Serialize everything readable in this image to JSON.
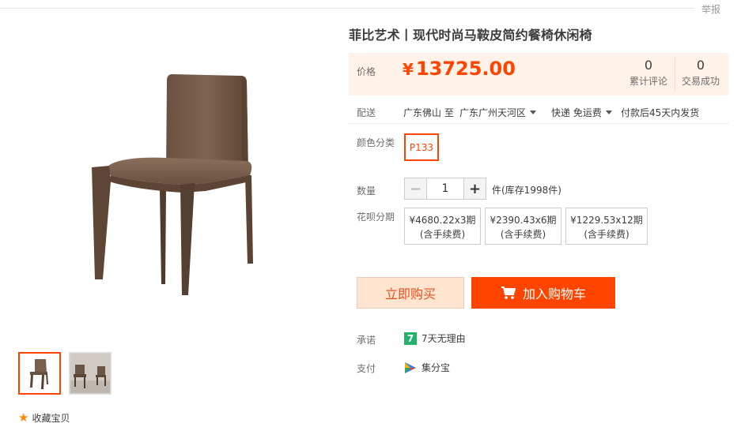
{
  "header": {
    "report_label": "举报"
  },
  "gallery": {
    "thumbs": [
      "chair-front",
      "chair-photo"
    ],
    "favorite_label": "收藏宝贝"
  },
  "product": {
    "title": "菲比艺术丨现代时尚马鞍皮简约餐椅休闲椅",
    "price_label": "价格",
    "currency": "¥",
    "price": "13725.00",
    "reviews_count": "0",
    "reviews_label": "累计评论",
    "deals_count": "0",
    "deals_label": "交易成功"
  },
  "shipping": {
    "label": "配送",
    "from": "广东佛山 至",
    "to": "广东广州天河区",
    "method": "快递 免运费",
    "delivery": "付款后45天内发货"
  },
  "sku": {
    "label": "颜色分类",
    "options": [
      "P133"
    ]
  },
  "quantity": {
    "label": "数量",
    "value": "1",
    "minus": "−",
    "plus": "+",
    "stock": "件(库存1998件)"
  },
  "installments": {
    "label": "花呗分期",
    "options": [
      {
        "amount": "¥4680.22x3期",
        "note": "(含手续费)"
      },
      {
        "amount": "¥2390.43x6期",
        "note": "(含手续费)"
      },
      {
        "amount": "¥1229.53x12期",
        "note": "(含手续费)"
      }
    ]
  },
  "actions": {
    "buy_now": "立即购买",
    "add_to_cart": "加入购物车"
  },
  "promise": {
    "label": "承诺",
    "icon_text": "7",
    "text": "7天无理由"
  },
  "payment": {
    "label": "支付",
    "text": "集分宝"
  },
  "colors": {
    "accent": "#ff4400",
    "price_bg": "#fff2e8",
    "buy_bg": "#ffe4d0",
    "promise_green": "#20b36a"
  }
}
